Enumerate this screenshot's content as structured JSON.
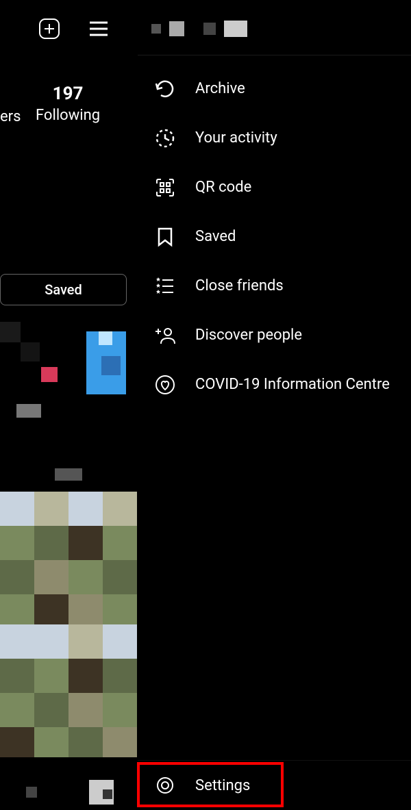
{
  "profile": {
    "following_count": "197",
    "following_label": "Following",
    "followers_suffix": "ers",
    "saved_button": "Saved"
  },
  "drawer": {
    "items": [
      {
        "label": "Archive",
        "icon": "archive"
      },
      {
        "label": "Your activity",
        "icon": "activity"
      },
      {
        "label": "QR code",
        "icon": "qr"
      },
      {
        "label": "Saved",
        "icon": "saved"
      },
      {
        "label": "Close friends",
        "icon": "closefriends"
      },
      {
        "label": "Discover people",
        "icon": "discover"
      },
      {
        "label": "COVID-19 Information Centre",
        "icon": "covid"
      }
    ],
    "settings_label": "Settings"
  }
}
